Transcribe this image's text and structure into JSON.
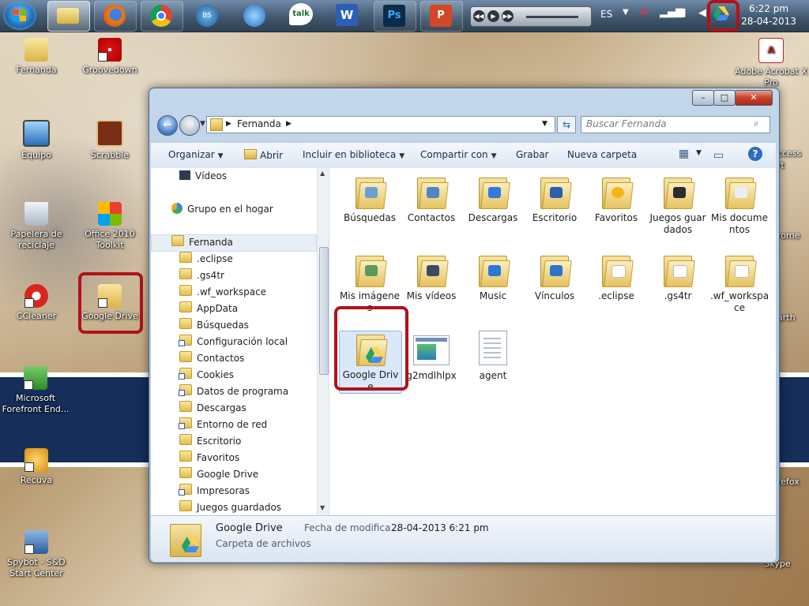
{
  "taskbar": {
    "language": "ES",
    "clock_time": "6:22 pm",
    "clock_date": "28-04-2013",
    "apps": [
      "windows-explorer",
      "firefox",
      "chrome",
      "bs-player",
      "itunes",
      "google-talk",
      "word",
      "photoshop",
      "powerpoint"
    ]
  },
  "desktop": {
    "icons": [
      {
        "label": "Fernanda"
      },
      {
        "label": "Groovedown"
      },
      {
        "label": "Equipo"
      },
      {
        "label": "Scrabble"
      },
      {
        "label": "Papelera de reciclaje"
      },
      {
        "label": "Office 2010 Toolkit"
      },
      {
        "label": "CCleaner"
      },
      {
        "label": "Google Drive"
      },
      {
        "label": "Microsoft Forefront End..."
      },
      {
        "label": "Recuva"
      },
      {
        "label": "Spybot - S&D Start Center"
      },
      {
        "label": "Adobe Acrobat X Pro"
      }
    ],
    "partial_right": [
      "ccess",
      "rt",
      "rome",
      "arth",
      "refox",
      "Skype"
    ]
  },
  "explorer": {
    "address": {
      "segment": "Fernanda"
    },
    "search_placeholder": "Buscar Fernanda",
    "toolbar": {
      "organize": "Organizar",
      "open": "Abrir",
      "include": "Incluir en biblioteca",
      "share": "Compartir con",
      "burn": "Grabar",
      "new_folder": "Nueva carpeta"
    },
    "nav": {
      "top": [
        {
          "label": "Vídeos"
        },
        {
          "label": "Grupo en el hogar"
        },
        {
          "label": "Fernanda"
        }
      ],
      "children": [
        {
          "label": ".eclipse",
          "shortcut": false
        },
        {
          "label": ".gs4tr",
          "shortcut": false
        },
        {
          "label": ".wf_workspace",
          "shortcut": false
        },
        {
          "label": "AppData",
          "shortcut": false
        },
        {
          "label": "Búsquedas",
          "shortcut": false
        },
        {
          "label": "Configuración local",
          "shortcut": true
        },
        {
          "label": "Contactos",
          "shortcut": false
        },
        {
          "label": "Cookies",
          "shortcut": true
        },
        {
          "label": "Datos de programa",
          "shortcut": true
        },
        {
          "label": "Descargas",
          "shortcut": false
        },
        {
          "label": "Entorno de red",
          "shortcut": true
        },
        {
          "label": "Escritorio",
          "shortcut": false
        },
        {
          "label": "Favoritos",
          "shortcut": false
        },
        {
          "label": "Google Drive",
          "shortcut": false
        },
        {
          "label": "Impresoras",
          "shortcut": true
        },
        {
          "label": "Juegos guardados",
          "shortcut": false
        }
      ]
    },
    "items": [
      {
        "label": "Búsquedas",
        "kind": "folder",
        "emblem": "magnifier"
      },
      {
        "label": "Contactos",
        "kind": "folder",
        "emblem": "contacts"
      },
      {
        "label": "Descargas",
        "kind": "folder",
        "emblem": "download-arrow"
      },
      {
        "label": "Escritorio",
        "kind": "folder",
        "emblem": "desktop"
      },
      {
        "label": "Favoritos",
        "kind": "folder",
        "emblem": "star"
      },
      {
        "label": "Juegos guardados",
        "kind": "folder",
        "emblem": "chess-piece"
      },
      {
        "label": "Mis documentos",
        "kind": "folder",
        "emblem": "documents"
      },
      {
        "label": "Mis imágenes",
        "kind": "folder",
        "emblem": "picture"
      },
      {
        "label": "Mis vídeos",
        "kind": "folder",
        "emblem": "film"
      },
      {
        "label": "Music",
        "kind": "folder",
        "emblem": "music-note"
      },
      {
        "label": "Vínculos",
        "kind": "folder",
        "emblem": "link-arrow"
      },
      {
        "label": ".eclipse",
        "kind": "folder",
        "emblem": "papers"
      },
      {
        "label": ".gs4tr",
        "kind": "folder",
        "emblem": "papers"
      },
      {
        "label": ".wf_workspace",
        "kind": "folder",
        "emblem": "papers"
      },
      {
        "label": "Google Drive",
        "kind": "folder",
        "emblem": "google-drive",
        "selected": true
      },
      {
        "label": "g2mdlhlpx",
        "kind": "file",
        "emblem": "window"
      },
      {
        "label": "agent",
        "kind": "file",
        "emblem": "text"
      }
    ],
    "details": {
      "name": "Google Drive",
      "type": "Carpeta de archivos",
      "modified_label": "Fecha de modifica...",
      "modified_value": "28-04-2013 6:21 pm"
    }
  },
  "colors": {
    "highlight": "#b1121a",
    "drive_green": "#1fa463",
    "drive_yellow": "#ffd04b",
    "drive_blue": "#4688f4"
  }
}
